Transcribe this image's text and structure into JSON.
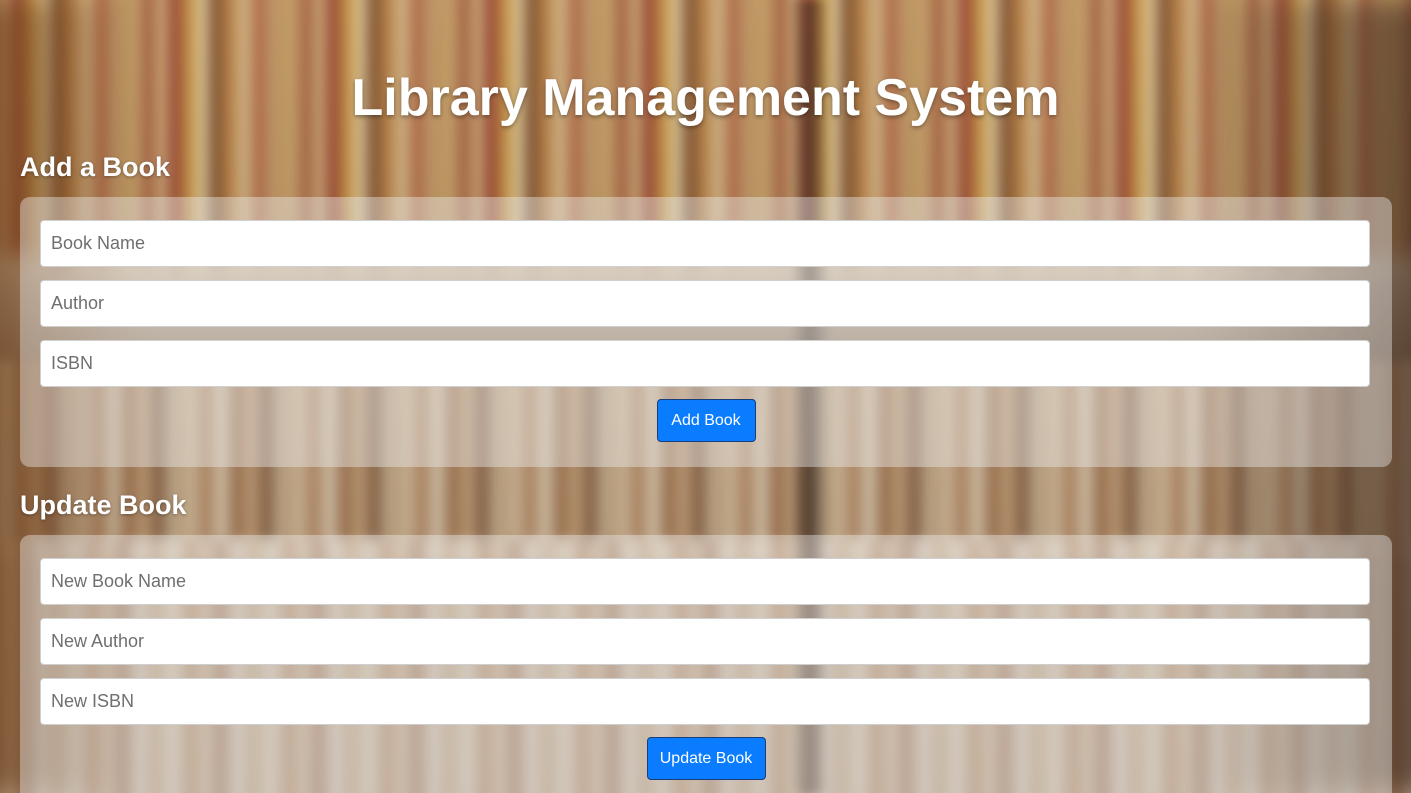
{
  "app": {
    "title": "Library Management System"
  },
  "add_section": {
    "heading": "Add a Book",
    "book_name_placeholder": "Book Name",
    "author_placeholder": "Author",
    "isbn_placeholder": "ISBN",
    "submit_label": "Add Book"
  },
  "update_section": {
    "heading": "Update Book",
    "book_name_placeholder": "New Book Name",
    "author_placeholder": "New Author",
    "isbn_placeholder": "New ISBN",
    "submit_label": "Update Book"
  },
  "colors": {
    "primary_button": "#0a7cff",
    "heading_text": "#ffffff"
  }
}
